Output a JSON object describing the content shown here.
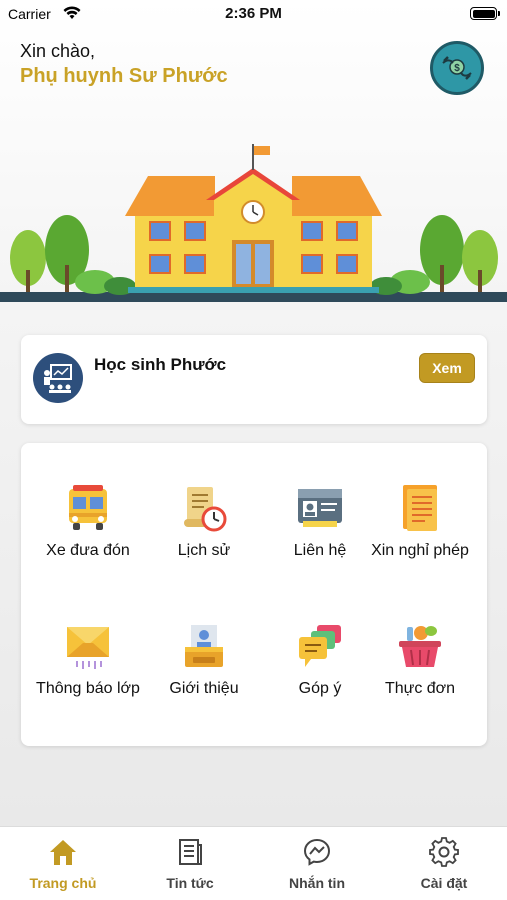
{
  "status_bar": {
    "carrier": "Carrier",
    "time": "2:36 PM"
  },
  "header": {
    "greeting": "Xin chào,",
    "parent_name": "Phụ huynh Sư Phước",
    "fee_icon": "money-hand-icon"
  },
  "student": {
    "name": "Học sinh Phước",
    "view_label": "Xem"
  },
  "menu": {
    "items": [
      {
        "label": "Xe đưa đón",
        "icon": "school-bus-icon"
      },
      {
        "label": "Lịch sử",
        "icon": "history-icon"
      },
      {
        "label": "Liên hệ",
        "icon": "contact-card-icon"
      },
      {
        "label": "Xin nghỉ phép",
        "icon": "leave-request-icon"
      },
      {
        "label": "Thông báo lớp",
        "icon": "class-notice-icon"
      },
      {
        "label": "Giới thiệu",
        "icon": "introduction-icon"
      },
      {
        "label": "Góp ý",
        "icon": "feedback-icon"
      },
      {
        "label": "Thực đơn",
        "icon": "menu-basket-icon"
      }
    ]
  },
  "tabs": [
    {
      "label": "Trang chủ",
      "icon": "home-icon",
      "active": true
    },
    {
      "label": "Tin tức",
      "icon": "news-icon",
      "active": false
    },
    {
      "label": "Nhắn tin",
      "icon": "messenger-icon",
      "active": false
    },
    {
      "label": "Cài đặt",
      "icon": "settings-icon",
      "active": false
    }
  ],
  "colors": {
    "accent": "#c29a23",
    "name": "#c9a227",
    "avatar": "#2d4f7c",
    "fee_button": "#2e97a6"
  }
}
